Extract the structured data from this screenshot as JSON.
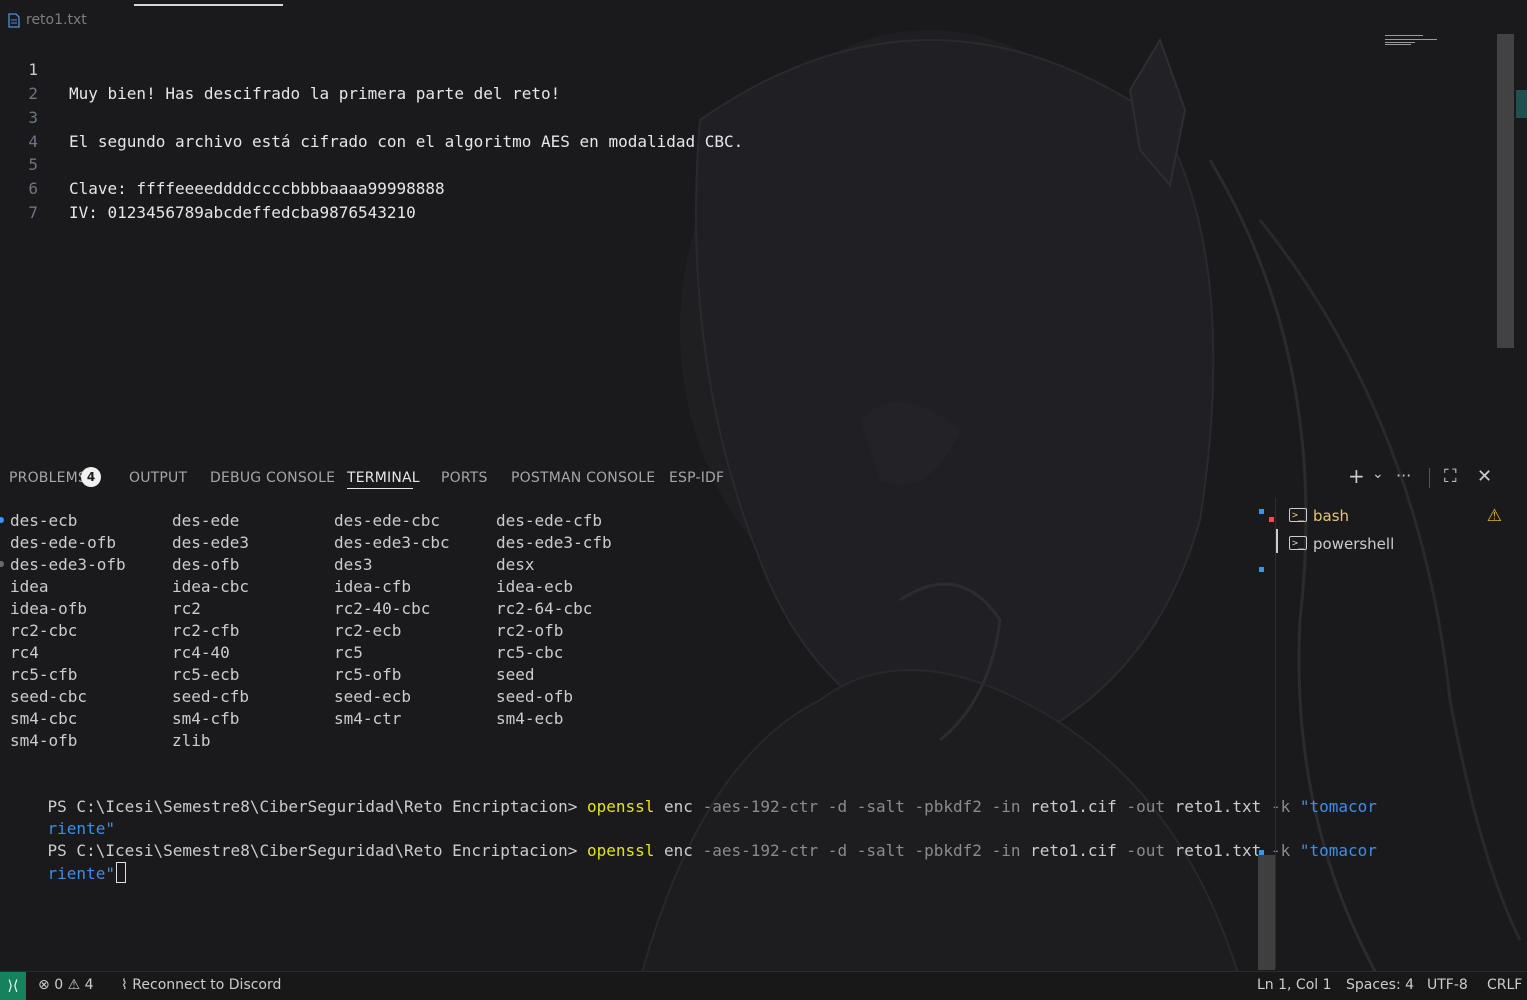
{
  "editor": {
    "file_name": "reto1.txt",
    "lines": [
      {
        "number": "1",
        "text": "Muy bien! Has descifrado la primera parte del reto!"
      },
      {
        "number": "2",
        "text": ""
      },
      {
        "number": "3",
        "text": "El segundo archivo está cifrado con el algoritmo AES en modalidad CBC."
      },
      {
        "number": "4",
        "text": ""
      },
      {
        "number": "5",
        "text": "Clave: ffffeeeeddddccccbbbbaaaa99998888"
      },
      {
        "number": "6",
        "text": "IV: 0123456789abcdeffedcba9876543210"
      },
      {
        "number": "7",
        "text": ""
      }
    ]
  },
  "panel": {
    "tabs": [
      "PROBLEMS",
      "OUTPUT",
      "DEBUG CONSOLE",
      "TERMINAL",
      "PORTS",
      "POSTMAN CONSOLE",
      "ESP-IDF"
    ],
    "active_tab": "TERMINAL",
    "problems_count": "4",
    "actions": {
      "add": "+",
      "dropdown": "⌄",
      "more": "···",
      "maximize": "⛶",
      "close": "✕"
    }
  },
  "terminal": {
    "cipher_rows": [
      [
        "des-ecb",
        "des-ede",
        "des-ede-cbc",
        "des-ede-cfb"
      ],
      [
        "des-ede-ofb",
        "des-ede3",
        "des-ede3-cbc",
        "des-ede3-cfb"
      ],
      [
        "des-ede3-ofb",
        "des-ofb",
        "des3",
        "desx"
      ],
      [
        "idea",
        "idea-cbc",
        "idea-cfb",
        "idea-ecb"
      ],
      [
        "idea-ofb",
        "rc2",
        "rc2-40-cbc",
        "rc2-64-cbc"
      ],
      [
        "rc2-cbc",
        "rc2-cfb",
        "rc2-ecb",
        "rc2-ofb"
      ],
      [
        "rc4",
        "rc4-40",
        "rc5",
        "rc5-cbc"
      ],
      [
        "rc5-cfb",
        "rc5-ecb",
        "rc5-ofb",
        "seed"
      ],
      [
        "seed-cbc",
        "seed-cfb",
        "seed-ecb",
        "seed-ofb"
      ],
      [
        "sm4-cbc",
        "sm4-cfb",
        "sm4-ctr",
        "sm4-ecb"
      ],
      [
        "sm4-ofb",
        "zlib",
        "",
        ""
      ]
    ],
    "prompt": "PS C:\\Icesi\\Semestre8\\CiberSeguridad\\Reto Encriptacion> ",
    "cmd": {
      "program": "openssl",
      "sub": " enc ",
      "flags1": "-aes-192-ctr -d -salt -pbkdf2 -in ",
      "infile": "reto1.cif",
      "flag_out": " -out ",
      "outfile": "reto1.txt",
      "flag_k": " -k ",
      "key_part1": "\"tomacor",
      "key_part2": "riente\""
    },
    "sessions": [
      {
        "name": "bash",
        "warning": true
      },
      {
        "name": "powershell",
        "warning": false
      }
    ]
  },
  "statusbar": {
    "errors": "0",
    "warnings": "4",
    "discord": "Reconnect to Discord",
    "position": "Ln 1, Col 1",
    "spaces": "Spaces: 4",
    "encoding": "UTF-8",
    "eol": "CRLF"
  },
  "colors": {
    "accent_remote": "#16825d",
    "prompt_cmd": "#e5e510",
    "string": "#3b8eea"
  }
}
